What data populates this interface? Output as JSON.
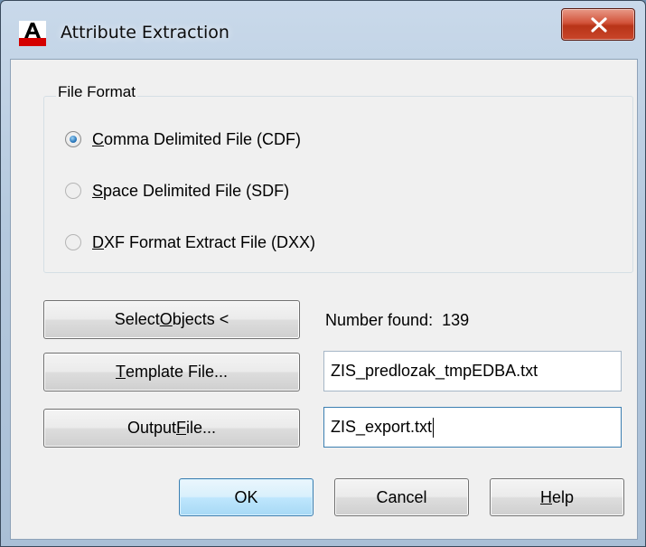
{
  "window": {
    "title": "Attribute Extraction",
    "app_icon": "autocad-icon",
    "close_icon": "close-x-icon"
  },
  "file_format": {
    "legend": "File Format",
    "options": [
      {
        "pre": "",
        "mnemonic": "C",
        "rest": "omma Delimited File (CDF)",
        "selected": true
      },
      {
        "pre": "",
        "mnemonic": "S",
        "rest": "pace Delimited File (SDF)",
        "selected": false
      },
      {
        "pre": "",
        "mnemonic": "D",
        "rest": "XF Format Extract File (DXX)",
        "selected": false
      }
    ]
  },
  "select_objects": {
    "pre": "Select ",
    "mnemonic": "O",
    "rest": "bjects <",
    "number_found_text": "Number found:  139"
  },
  "template_file": {
    "pre": "",
    "mnemonic": "T",
    "rest": "emplate File...",
    "value": "ZIS_predlozak_tmpEDBA.txt"
  },
  "output_file": {
    "pre": "Output ",
    "mnemonic": "F",
    "rest": "ile...",
    "value": "ZIS_export.txt"
  },
  "buttons": {
    "ok": "OK",
    "cancel": "Cancel",
    "help_mnemonic": "H",
    "help_rest": "elp"
  },
  "colors": {
    "accent": "#2b79bd",
    "close_button": "#c9462a",
    "autocad_red": "#d40000"
  }
}
